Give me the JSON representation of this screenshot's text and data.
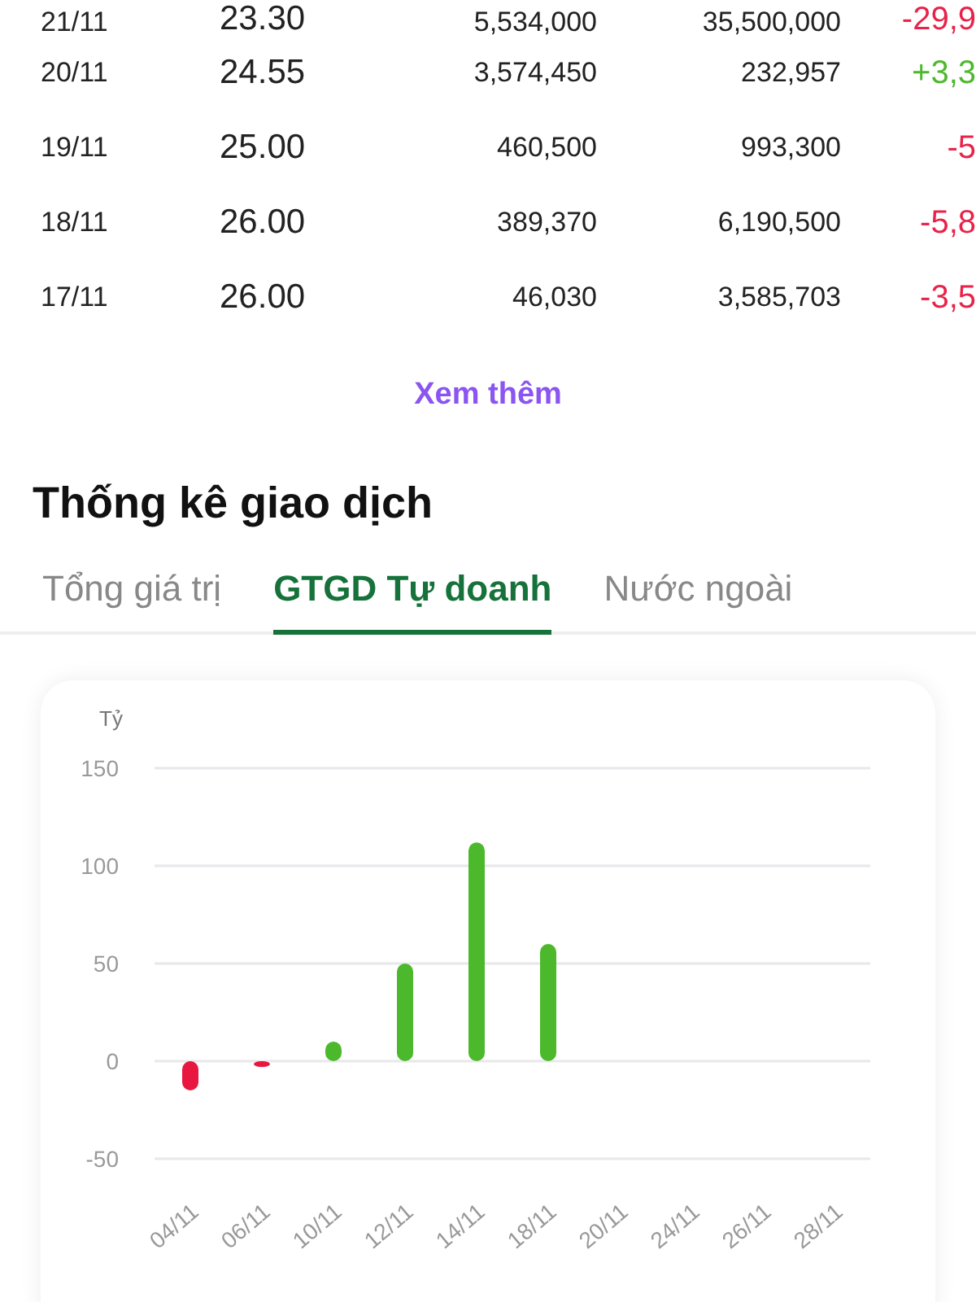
{
  "table": {
    "rows": [
      {
        "date": "21/11",
        "price": "23.30",
        "volume": "5,534,000",
        "value": "35,500,000",
        "change": "-29,9",
        "color": "#e8234a"
      },
      {
        "date": "20/11",
        "price": "24.55",
        "volume": "3,574,450",
        "value": "232,957",
        "change": "+3,3",
        "color": "#4cb82c"
      },
      {
        "date": "19/11",
        "price": "25.00",
        "volume": "460,500",
        "value": "993,300",
        "change": "-5",
        "color": "#e8234a"
      },
      {
        "date": "18/11",
        "price": "26.00",
        "volume": "389,370",
        "value": "6,190,500",
        "change": "-5,8",
        "color": "#e8234a"
      },
      {
        "date": "17/11",
        "price": "26.00",
        "volume": "46,030",
        "value": "3,585,703",
        "change": "-3,5",
        "color": "#e8234a"
      }
    ]
  },
  "more_link": "Xem thêm",
  "section_title": "Thống kê giao dịch",
  "tabs": [
    {
      "label": "Tổng giá trị",
      "selected": false
    },
    {
      "label": "GTGD Tự doanh",
      "selected": true
    },
    {
      "label": "Nước ngoài",
      "selected": false
    }
  ],
  "chart": {
    "chart_data": {
      "type": "bar",
      "ylabel": "Tỷ",
      "categories": [
        "04/11",
        "06/11",
        "10/11",
        "12/11",
        "14/11",
        "18/11",
        "20/11",
        "24/11",
        "26/11",
        "28/11"
      ],
      "series": [
        {
          "color": "#4cb82c",
          "values": [
            null,
            null,
            10,
            50,
            112,
            60,
            null,
            null,
            null,
            null
          ]
        },
        {
          "color": "#e8173f",
          "values": [
            -15,
            -3,
            null,
            null,
            null,
            null,
            null,
            null,
            null,
            null
          ]
        }
      ],
      "stacked": true,
      "grid": true,
      "ylim": [
        -50,
        150
      ],
      "yticks": [
        -50,
        0,
        50,
        100,
        150
      ]
    }
  }
}
